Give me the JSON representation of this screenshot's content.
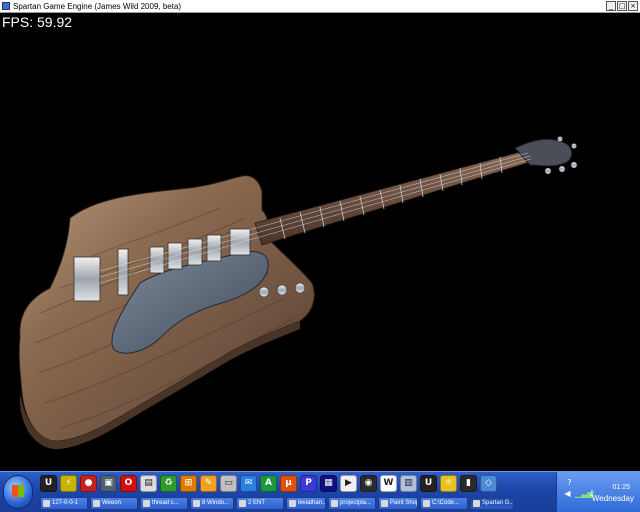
{
  "window": {
    "title": "Spartan Game Engine (James Wild 2009, beta)",
    "controls": [
      "_",
      "□",
      "×"
    ]
  },
  "viewport": {
    "fps_label": "FPS: 59.92"
  },
  "taskbar": {
    "quick_launch": [
      {
        "icon": "ue-icon",
        "glyph": "U",
        "color": "#222222"
      },
      {
        "icon": "winamp-icon",
        "glyph": "⚡",
        "color": "#c8b400"
      },
      {
        "icon": "flashget-icon",
        "glyph": "●",
        "color": "#c82020"
      },
      {
        "icon": "network-icon",
        "glyph": "▣",
        "color": "#506070"
      },
      {
        "icon": "opera-icon",
        "glyph": "O",
        "color": "#d01010"
      },
      {
        "icon": "chart-icon",
        "glyph": "▤",
        "color": "#dddddd"
      },
      {
        "icon": "recycle-icon",
        "glyph": "♻",
        "color": "#2e9b2e"
      },
      {
        "icon": "windows-icon",
        "glyph": "⊞",
        "color": "#e07a00"
      },
      {
        "icon": "paint-icon",
        "glyph": "✎",
        "color": "#f0a020"
      },
      {
        "icon": "file-icon",
        "glyph": "▭",
        "color": "#c0c0c0"
      },
      {
        "icon": "chat-icon",
        "glyph": "✉",
        "color": "#2a7fe0"
      },
      {
        "icon": "app-icon",
        "glyph": "A",
        "color": "#1a9a3a"
      },
      {
        "icon": "torrent-icon",
        "glyph": "µ",
        "color": "#e05010"
      },
      {
        "icon": "paint-shop-icon",
        "glyph": "P",
        "color": "#3a3ad8"
      },
      {
        "icon": "tool-icon",
        "glyph": "▦",
        "color": "#101080"
      },
      {
        "icon": "media-icon",
        "glyph": "▶",
        "color": "#f0f0f0"
      },
      {
        "icon": "disc-icon",
        "glyph": "◉",
        "color": "#2a2a2a"
      },
      {
        "icon": "doc-icon",
        "glyph": "W",
        "color": "#ffffff"
      },
      {
        "icon": "grid-icon",
        "glyph": "▥",
        "color": "#b0c0e0"
      },
      {
        "icon": "ue2-icon",
        "glyph": "U",
        "color": "#222222"
      },
      {
        "icon": "sky-icon",
        "glyph": "☼",
        "color": "#e8c020"
      },
      {
        "icon": "game-icon",
        "glyph": "▮",
        "color": "#2a2a2a"
      },
      {
        "icon": "vbox-icon",
        "glyph": "◇",
        "color": "#4a8ad8"
      }
    ],
    "tasks": [
      {
        "label": "127-0-0-1",
        "width": 48,
        "active": false
      },
      {
        "label": "Weeon",
        "width": 48,
        "active": false
      },
      {
        "label": "thread c...",
        "width": 48,
        "active": false
      },
      {
        "label": "8 Windo...",
        "width": 44,
        "active": false
      },
      {
        "label": "2 ENT",
        "width": 48,
        "active": false
      },
      {
        "label": "leviathan...",
        "width": 40,
        "active": false
      },
      {
        "label": "projectpla...",
        "width": 48,
        "active": false
      },
      {
        "label": "Paint Shop...",
        "width": 40,
        "active": false
      },
      {
        "label": "C:\\Code...",
        "width": 48,
        "active": false
      },
      {
        "label": "Spartan G...",
        "width": 44,
        "active": true
      }
    ],
    "tray": {
      "time": "01:25",
      "day": "Wednesday"
    }
  }
}
